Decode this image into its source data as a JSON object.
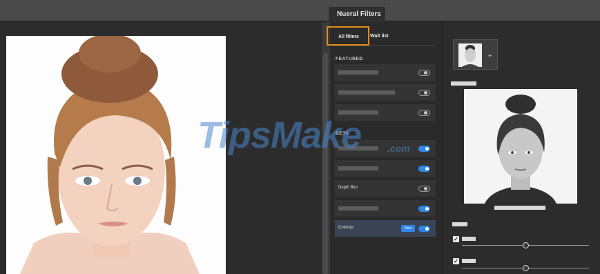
{
  "window": {
    "title_tab": "Nueral Filters"
  },
  "tabs": [
    {
      "label": "All filters",
      "active": true
    },
    {
      "label": "Wait list",
      "active": false
    }
  ],
  "sections": {
    "featured": "FEATURED",
    "beta": "BETA"
  },
  "filters": [
    {
      "section": "featured",
      "label": "",
      "on": false
    },
    {
      "section": "featured",
      "label": "",
      "on": false
    },
    {
      "section": "featured",
      "label": "",
      "on": false
    },
    {
      "section": "beta",
      "label": "",
      "on": true
    },
    {
      "section": "beta",
      "label": "",
      "on": true
    },
    {
      "section": "beta",
      "label": "Depth Blur",
      "on": false
    },
    {
      "section": "beta",
      "label": "",
      "on": true
    },
    {
      "section": "beta",
      "label": "Colorize",
      "badge": "New",
      "on": true,
      "selected": true
    }
  ],
  "preview": {
    "sliders": [
      {
        "checked": true,
        "value": 0.5
      },
      {
        "checked": true,
        "value": 0.5
      }
    ]
  },
  "watermark": {
    "main": "TipsMake",
    "suffix": ".com"
  },
  "colors": {
    "accent": "#2f86e6",
    "highlight": "#e58a1c",
    "panel": "#2a2a2a"
  },
  "icons": {
    "dropdown": "chevron-down-icon",
    "check": "checkbox-icon"
  }
}
